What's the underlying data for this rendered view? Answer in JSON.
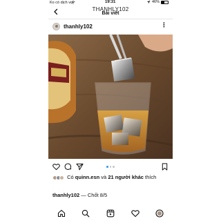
{
  "status_bar": {
    "carrier": "Ko có dịch vụ",
    "time": "19:31",
    "battery": "46%",
    "battery_level": 0.46
  },
  "header": {
    "handle_overlay": "THANHLY102",
    "title": "Bài viết"
  },
  "post": {
    "username": "thanhly102",
    "more_label": "⋮",
    "image_description": "whiskey stones in glass",
    "carousel": {
      "count": 3,
      "active_index": 0
    },
    "likes": {
      "prefix": "Có",
      "liker": "quinn.esn",
      "connector": "và",
      "others": "21 người khác",
      "suffix": "thích"
    },
    "caption": {
      "username": "thanhly102",
      "text": "— Chốt 8/5"
    }
  },
  "icons": {
    "back": "chevron-left-icon",
    "like": "heart-icon",
    "comment": "comment-icon",
    "share": "send-icon",
    "save": "bookmark-icon",
    "tabs": [
      "home-icon",
      "search-icon",
      "reels-icon",
      "activity-heart-icon",
      "profile-icon"
    ]
  },
  "colors": {
    "accent": "#3897f0",
    "text": "#111111",
    "muted_dot": "#c7c7c7"
  }
}
